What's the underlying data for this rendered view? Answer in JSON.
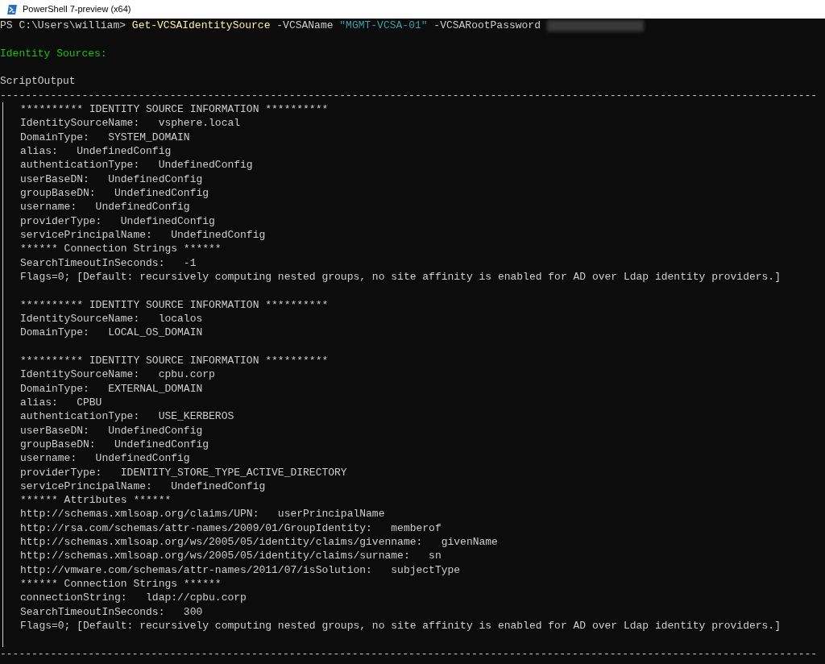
{
  "window": {
    "title": "PowerShell 7-preview (x64)"
  },
  "prompt": {
    "text": "PS C:\\Users\\william> ",
    "command": "Get-VCSAIdentitySource",
    "args": [
      {
        "kind": "param",
        "text": "-VCSAName"
      },
      {
        "kind": "string",
        "text": "\"MGMT-VCSA-01\""
      },
      {
        "kind": "param",
        "text": "-VCSARootPassword"
      },
      {
        "kind": "redacted"
      }
    ]
  },
  "heading": "Identity Sources:",
  "output_label": "ScriptOutput",
  "separator": "----------------------------------------------------------------------------------------------------------------------------------",
  "lines": [
    {
      "kind": "text",
      "text": "********** IDENTITY SOURCE INFORMATION **********"
    },
    {
      "kind": "text",
      "text": "IdentitySourceName:   vsphere.local"
    },
    {
      "kind": "text",
      "text": "DomainType:   SYSTEM_DOMAIN"
    },
    {
      "kind": "text",
      "text": "alias:   UndefinedConfig"
    },
    {
      "kind": "text",
      "text": "authenticationType:   UndefinedConfig"
    },
    {
      "kind": "text",
      "text": "userBaseDN:   UndefinedConfig"
    },
    {
      "kind": "text",
      "text": "groupBaseDN:   UndefinedConfig"
    },
    {
      "kind": "text",
      "text": "username:   UndefinedConfig"
    },
    {
      "kind": "text",
      "text": "providerType:   UndefinedConfig"
    },
    {
      "kind": "text",
      "text": "servicePrincipalName:   UndefinedConfig"
    },
    {
      "kind": "text",
      "text": "****** Connection Strings ******"
    },
    {
      "kind": "text",
      "text": "SearchTimeoutInSeconds:   -1"
    },
    {
      "kind": "text",
      "text": "Flags=0; [Default: recursively computing nested groups, no site affinity is enabled for AD over Ldap identity providers.]"
    },
    {
      "kind": "blank"
    },
    {
      "kind": "text",
      "text": "********** IDENTITY SOURCE INFORMATION **********"
    },
    {
      "kind": "text",
      "text": "IdentitySourceName:   localos"
    },
    {
      "kind": "text",
      "text": "DomainType:   LOCAL_OS_DOMAIN"
    },
    {
      "kind": "blank"
    },
    {
      "kind": "text",
      "text": "********** IDENTITY SOURCE INFORMATION **********"
    },
    {
      "kind": "text",
      "text": "IdentitySourceName:   cpbu.corp"
    },
    {
      "kind": "text",
      "text": "DomainType:   EXTERNAL_DOMAIN"
    },
    {
      "kind": "text",
      "text": "alias:   CPBU"
    },
    {
      "kind": "text",
      "text": "authenticationType:   USE_KERBEROS"
    },
    {
      "kind": "text",
      "text": "userBaseDN:   UndefinedConfig"
    },
    {
      "kind": "text",
      "text": "groupBaseDN:   UndefinedConfig"
    },
    {
      "kind": "text",
      "text": "username:   UndefinedConfig"
    },
    {
      "kind": "text",
      "text": "providerType:   IDENTITY_STORE_TYPE_ACTIVE_DIRECTORY"
    },
    {
      "kind": "text",
      "text": "servicePrincipalName:   UndefinedConfig"
    },
    {
      "kind": "text",
      "text": "****** Attributes ******"
    },
    {
      "kind": "text",
      "text": "http://schemas.xmlsoap.org/claims/UPN:   userPrincipalName"
    },
    {
      "kind": "text",
      "text": "http://rsa.com/schemas/attr-names/2009/01/GroupIdentity:   memberof"
    },
    {
      "kind": "text",
      "text": "http://schemas.xmlsoap.org/ws/2005/05/identity/claims/givenname:   givenName"
    },
    {
      "kind": "text",
      "text": "http://schemas.xmlsoap.org/ws/2005/05/identity/claims/surname:   sn"
    },
    {
      "kind": "text",
      "text": "http://vmware.com/schemas/attr-names/2011/07/isSolution:   subjectType"
    },
    {
      "kind": "text",
      "text": "****** Connection Strings ******"
    },
    {
      "kind": "text",
      "text": "connectionString:   ldap://cpbu.corp"
    },
    {
      "kind": "text",
      "text": "SearchTimeoutInSeconds:   300"
    },
    {
      "kind": "text",
      "text": "Flags=0; [Default: recursively computing nested groups, no site affinity is enabled for AD over Ldap identity providers.]"
    },
    {
      "kind": "blank"
    }
  ]
}
